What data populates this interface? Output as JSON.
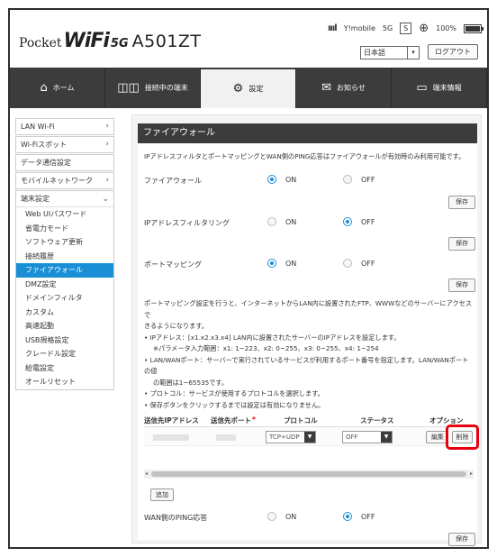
{
  "header": {
    "logo_pocket": "Pocket",
    "logo_wifi": "WiFi",
    "logo_5g": "5G",
    "logo_model": "A501ZT",
    "signal": "ıııl",
    "carrier": "Y!mobile",
    "network": "5G",
    "sim_badge": "S",
    "battery": "100%",
    "language": "日本語",
    "logout": "ログアウト"
  },
  "nav": [
    {
      "label": "ホーム",
      "icon": "⌂"
    },
    {
      "label": "接続中の端末",
      "icon": "◫◫"
    },
    {
      "label": "設定",
      "icon": "⚙"
    },
    {
      "label": "お知らせ",
      "icon": "✉"
    },
    {
      "label": "端末情報",
      "icon": "▭"
    }
  ],
  "sidebar": {
    "items": [
      {
        "label": "LAN Wi-Fi",
        "chev": "›"
      },
      {
        "label": "Wi-Fiスポット",
        "chev": "›"
      },
      {
        "label": "データ通信設定",
        "chev": ""
      },
      {
        "label": "モバイルネットワーク",
        "chev": "›"
      }
    ],
    "group": {
      "label": "端末設定",
      "chev": "⌄",
      "subs": [
        "Web UIパスワード",
        "省電力モード",
        "ソフトウェア更新",
        "接続履歴",
        "ファイアウォール",
        "DMZ設定",
        "ドメインフィルタ",
        "カスタム",
        "高速起動",
        "USB規格設定",
        "クレードル設定",
        "給電設定",
        "オールリセット"
      ]
    }
  },
  "main": {
    "title": "ファイアウォール",
    "intro": "IPアドレスフィルタとポートマッピングとWAN側のPING応答はファイアウォールが有効時のみ利用可能です。",
    "on": "ON",
    "off": "OFF",
    "save": "保存",
    "firewall_label": "ファイアウォール",
    "ipfilter_label": "IPアドレスフィルタリング",
    "portmap_label": "ポートマッピング",
    "notes": [
      "ポートマッピング設定を行うと、インターネットからLAN内に設置されたFTP、WWWなどのサーバーにアクセスで",
      "きるようになります。",
      "• IPアドレス：[x1.x2.x3.x4] LAN内に設置されたサーバーのIPアドレスを設定します。",
      "※パラメータ入力範囲：x1: 1~223、x2: 0~255、x3: 0~255、x4: 1~254",
      "• LAN/WANポート：サーバーで実行されているサービスが利用するポート番号を指定します。LAN/WANポートの値",
      "の範囲は1~65535です。",
      "• プロトコル：サービスが使用するプロトコルを選択します。",
      "• 保存ボタンをクリックするまでは設定は有効になりません。"
    ],
    "table": {
      "headers": [
        "送信先IPアドレス",
        "送信先ポート",
        "*",
        "プロトコル",
        "ステータス",
        "オプション"
      ],
      "row": {
        "protocol": "TCP+UDP",
        "status": "OFF",
        "edit": "編集",
        "delete": "削除"
      }
    },
    "add": "追加",
    "ping_label": "WAN側のPING応答"
  }
}
